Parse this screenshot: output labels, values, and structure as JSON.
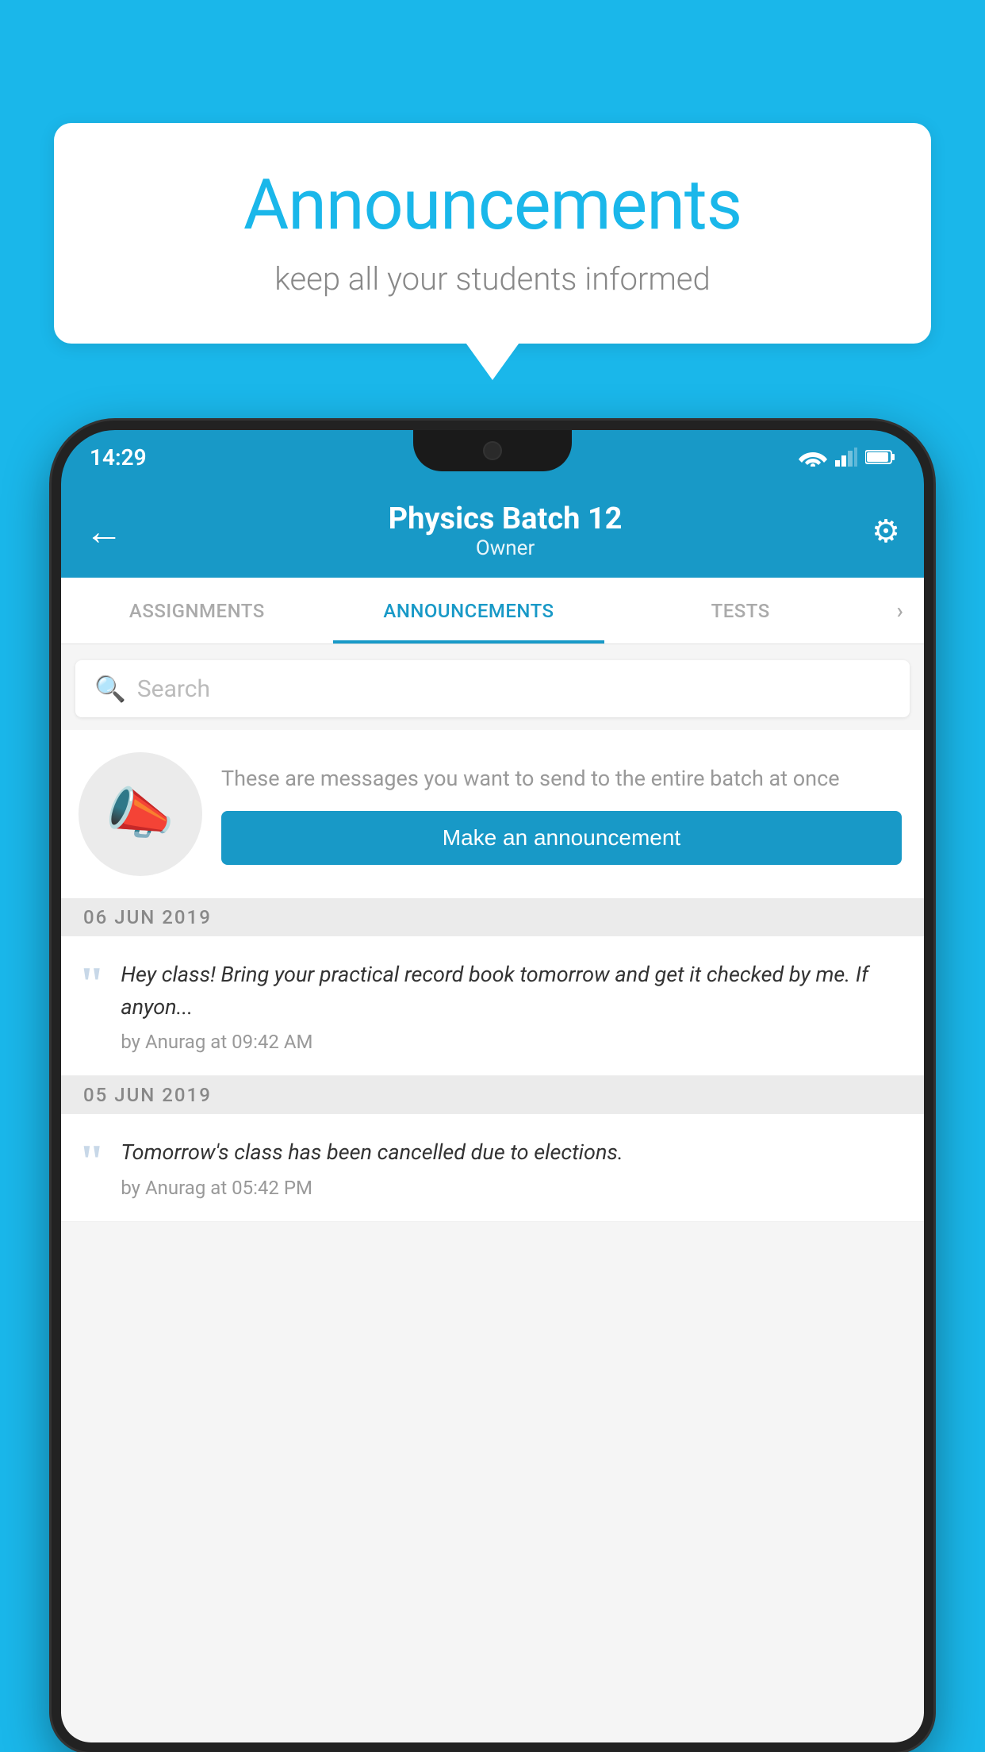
{
  "page": {
    "background_color": "#1ab7ea"
  },
  "speech_bubble": {
    "title": "Announcements",
    "subtitle": "keep all your students informed"
  },
  "status_bar": {
    "time": "14:29"
  },
  "app_bar": {
    "title": "Physics Batch 12",
    "subtitle": "Owner",
    "back_label": "←",
    "settings_label": "⚙"
  },
  "tabs": [
    {
      "label": "ASSIGNMENTS",
      "active": false
    },
    {
      "label": "ANNOUNCEMENTS",
      "active": true
    },
    {
      "label": "TESTS",
      "active": false
    }
  ],
  "search": {
    "placeholder": "Search"
  },
  "promo": {
    "description": "These are messages you want to send to the entire batch at once",
    "button_label": "Make an announcement"
  },
  "announcements": [
    {
      "date": "06  JUN  2019",
      "text": "Hey class! Bring your practical record book tomorrow and get it checked by me. If anyon...",
      "meta": "by Anurag at 09:42 AM"
    },
    {
      "date": "05  JUN  2019",
      "text": "Tomorrow's class has been cancelled due to elections.",
      "meta": "by Anurag at 05:42 PM"
    }
  ]
}
